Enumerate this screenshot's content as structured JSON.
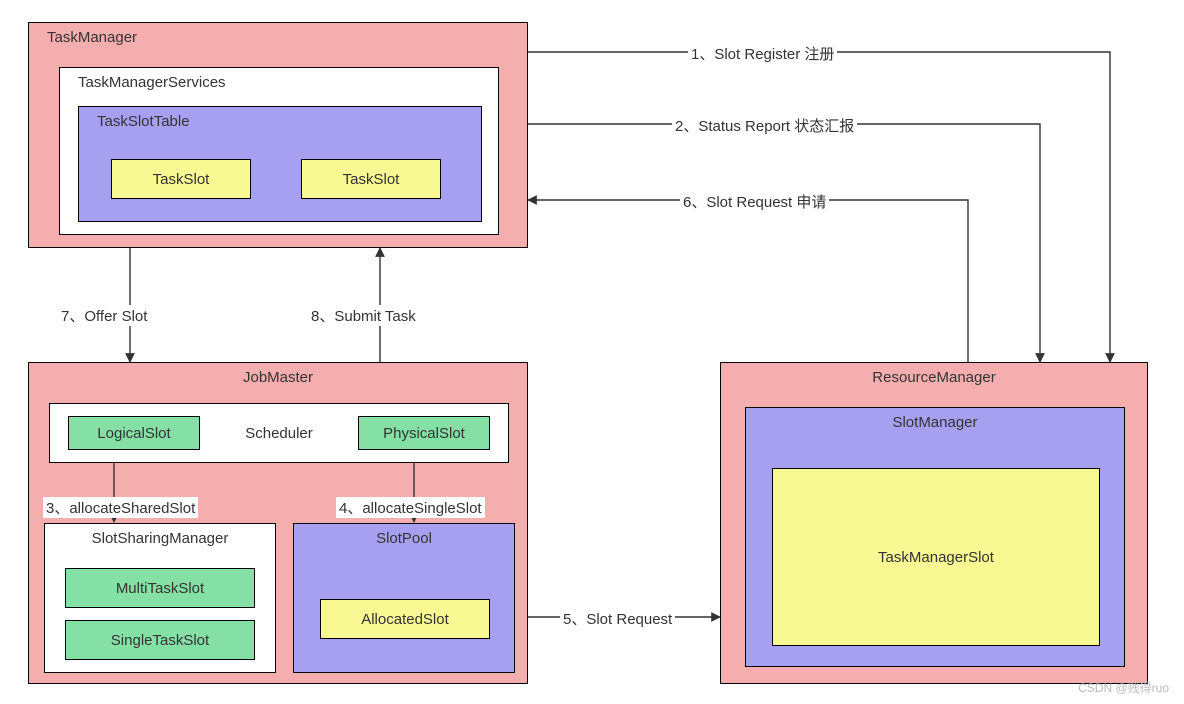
{
  "boxes": {
    "taskManager": "TaskManager",
    "taskManagerServices": "TaskManagerServices",
    "taskSlotTable": "TaskSlotTable",
    "taskSlot1": "TaskSlot",
    "taskSlot2": "TaskSlot",
    "jobMaster": "JobMaster",
    "scheduler": "Scheduler",
    "logicalSlot": "LogicalSlot",
    "physicalSlot": "PhysicalSlot",
    "slotSharingManager": "SlotSharingManager",
    "multiTaskSlot": "MultiTaskSlot",
    "singleTaskSlot": "SingleTaskSlot",
    "slotPool": "SlotPool",
    "allocatedSlot": "AllocatedSlot",
    "resourceManager": "ResourceManager",
    "slotManager": "SlotManager",
    "taskManagerSlot": "TaskManagerSlot"
  },
  "edges": {
    "e1": "1、Slot Register 注册",
    "e2": "2、Status Report 状态汇报",
    "e3": "3、allocateSharedSlot",
    "e4": "4、allocateSingleSlot",
    "e5": "5、Slot Request",
    "e6": "6、Slot Request 申请",
    "e7": "7、Offer Slot",
    "e8": "8、Submit Task"
  },
  "watermark": "CSDN @贱得ruo"
}
